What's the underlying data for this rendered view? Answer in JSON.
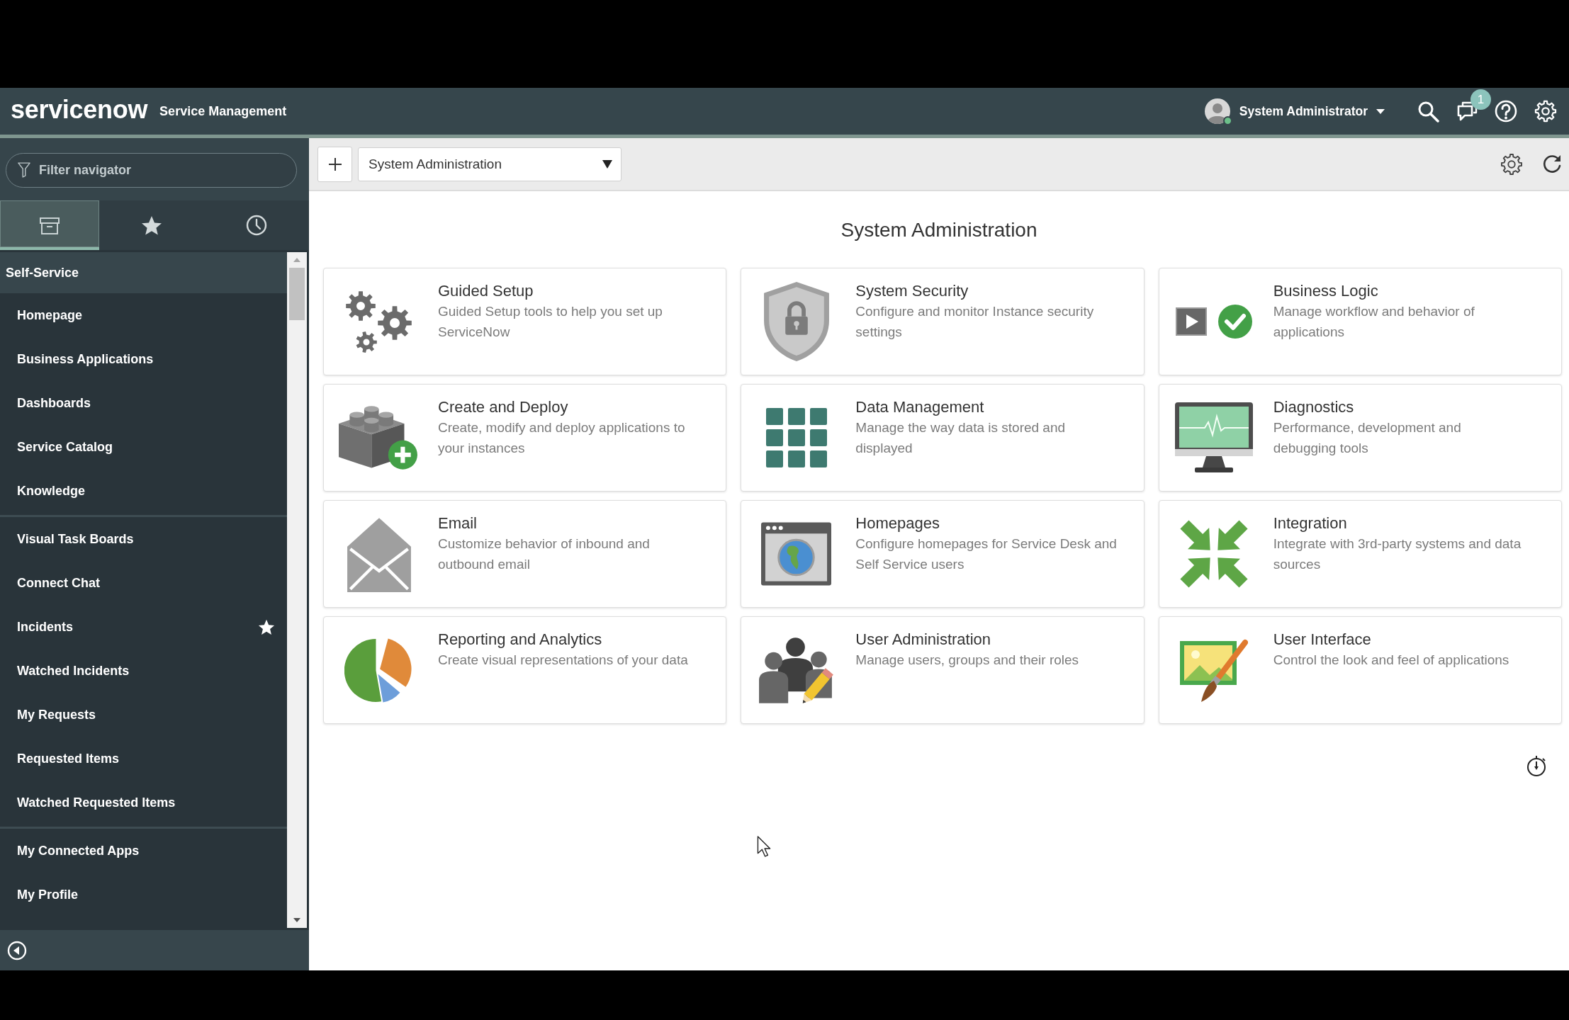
{
  "header": {
    "logo": "servicenow",
    "product": "Service Management",
    "user": {
      "name": "System Administrator",
      "online": true
    },
    "notifications": "1"
  },
  "navigator": {
    "filter": {
      "placeholder": "Filter navigator"
    },
    "tabs": [
      {
        "kind": "all",
        "selected": true
      },
      {
        "kind": "favorites",
        "selected": false
      },
      {
        "kind": "history",
        "selected": false
      }
    ],
    "application": {
      "title": "Self-Service",
      "groups": [
        {
          "items": [
            {
              "label": "Homepage",
              "favorite": false
            },
            {
              "label": "Business Applications",
              "favorite": false
            },
            {
              "label": "Dashboards",
              "favorite": false
            },
            {
              "label": "Service Catalog",
              "favorite": false
            },
            {
              "label": "Knowledge",
              "favorite": false
            }
          ]
        },
        {
          "items": [
            {
              "label": "Visual Task Boards",
              "favorite": false
            },
            {
              "label": "Connect Chat",
              "favorite": false
            },
            {
              "label": "Incidents",
              "favorite": true
            },
            {
              "label": "Watched Incidents",
              "favorite": false
            },
            {
              "label": "My Requests",
              "favorite": false
            },
            {
              "label": "Requested Items",
              "favorite": false
            },
            {
              "label": "Watched Requested Items",
              "favorite": false
            }
          ]
        },
        {
          "items": [
            {
              "label": "My Connected Apps",
              "favorite": false
            },
            {
              "label": "My Profile",
              "favorite": false
            }
          ]
        }
      ]
    }
  },
  "toolbar": {
    "dashboard": "System Administration"
  },
  "page": {
    "title": "System Administration",
    "cards": [
      {
        "kind": "gears",
        "title": "Guided Setup",
        "description": "Guided Setup tools to help you set up ServiceNow"
      },
      {
        "kind": "shield",
        "title": "System Security",
        "description": "Configure and monitor Instance security settings"
      },
      {
        "kind": "play-check",
        "title": "Business Logic",
        "description": "Manage workflow and behavior of applications"
      },
      {
        "kind": "blocks",
        "title": "Create and Deploy",
        "description": "Create, modify and deploy applications to your instances"
      },
      {
        "kind": "grid",
        "title": "Data Management",
        "description": "Manage the way data is stored and displayed"
      },
      {
        "kind": "monitor",
        "title": "Diagnostics",
        "description": "Performance, development and debugging tools"
      },
      {
        "kind": "envelope",
        "title": "Email",
        "description": "Customize behavior of inbound and outbound email"
      },
      {
        "kind": "browser",
        "title": "Homepages",
        "description": "Configure homepages for Service Desk and Self Service users"
      },
      {
        "kind": "arrows",
        "title": "Integration",
        "description": "Integrate with 3rd-party systems and data sources"
      },
      {
        "kind": "pie",
        "title": "Reporting and Analytics",
        "description": "Create visual representations of your data"
      },
      {
        "kind": "people",
        "title": "User Administration",
        "description": "Manage users, groups and their roles"
      },
      {
        "kind": "picture",
        "title": "User Interface",
        "description": "Control the look and feel of applications"
      }
    ]
  }
}
